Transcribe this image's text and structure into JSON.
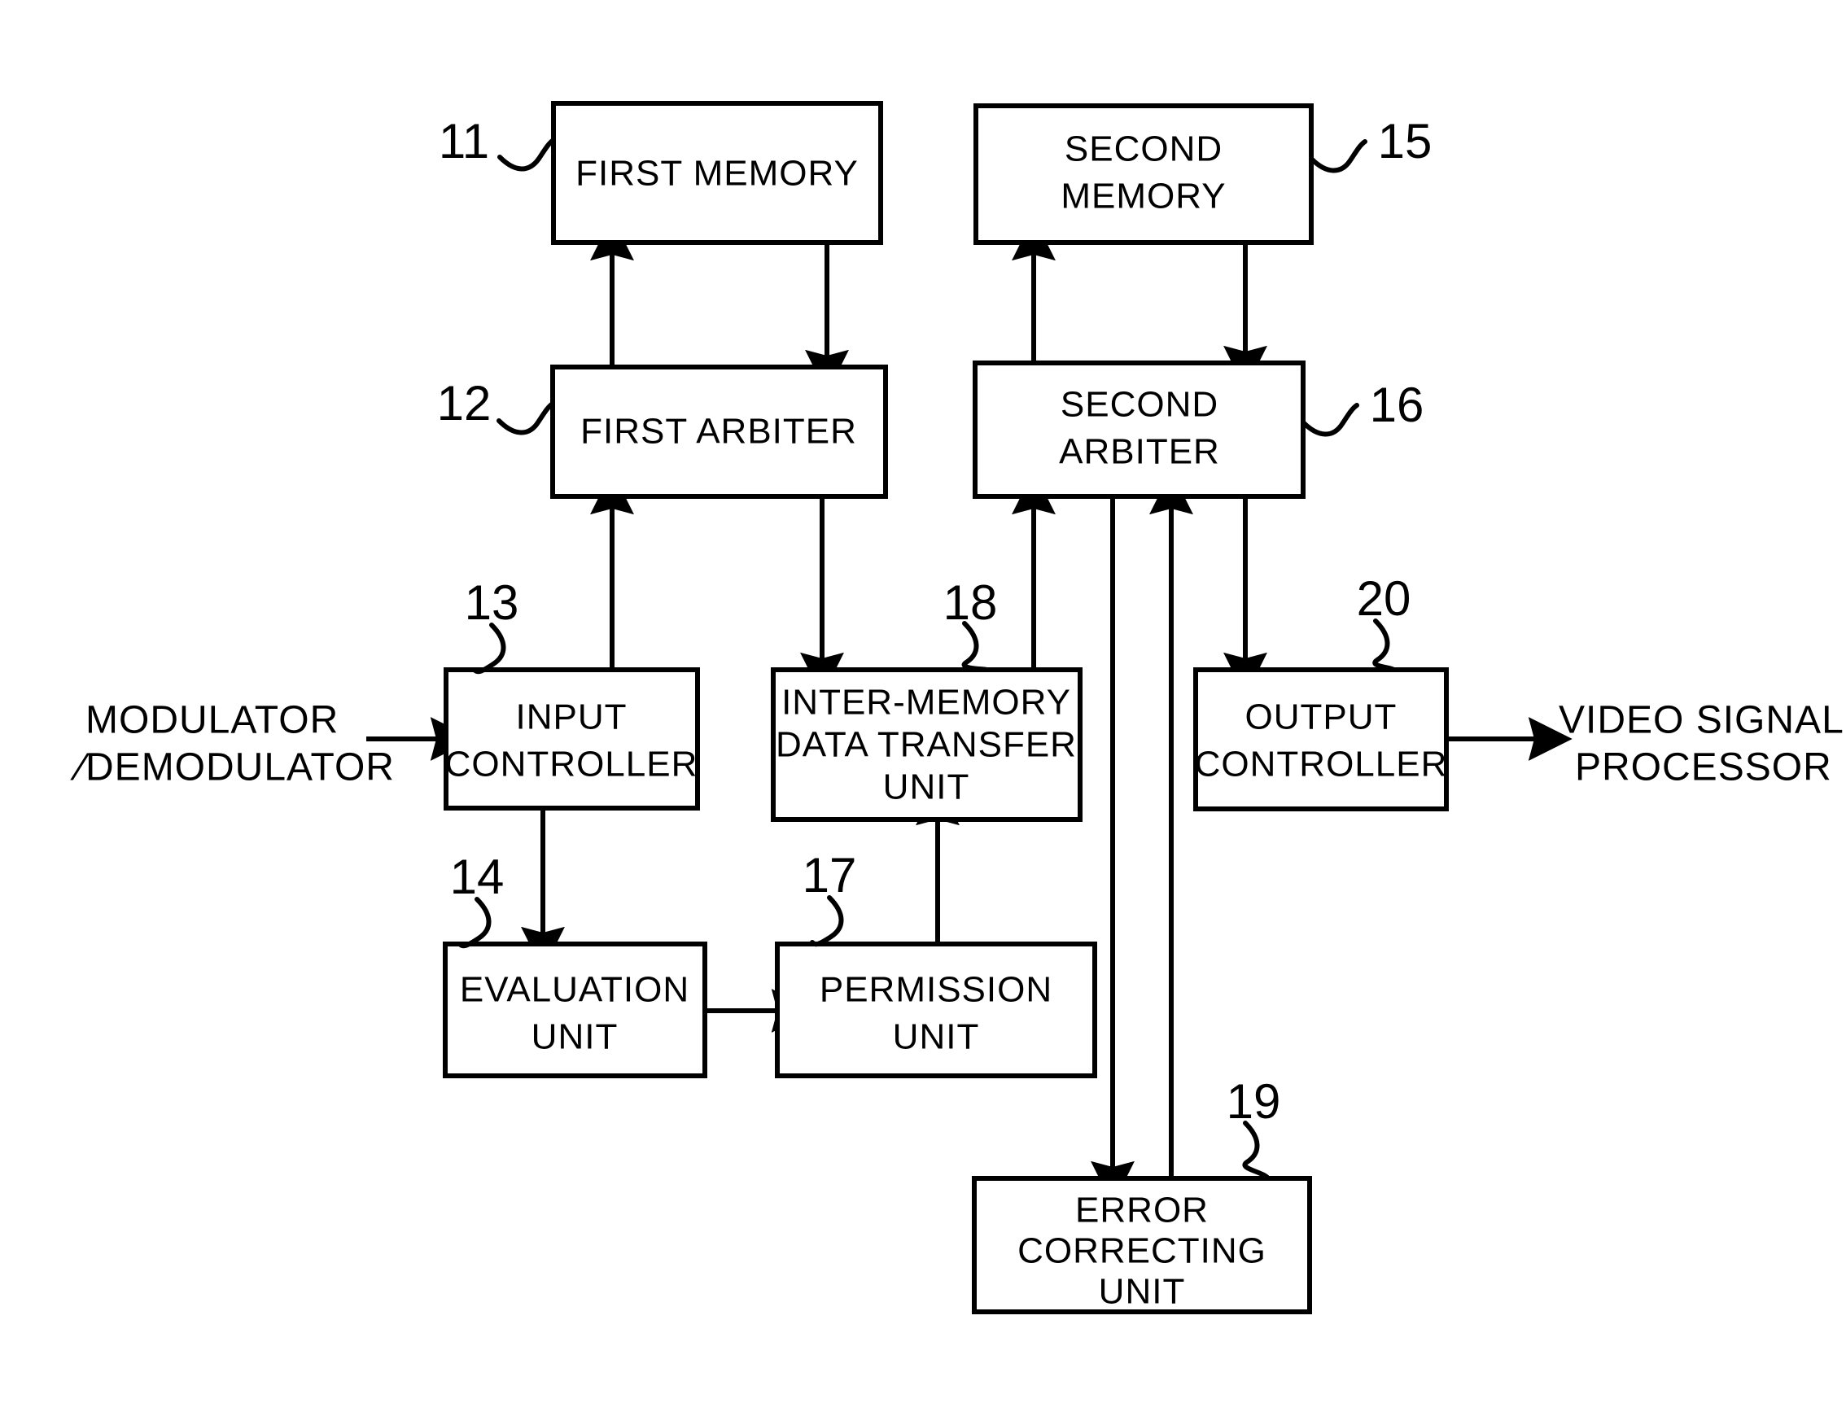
{
  "figure": {
    "type": "patent-block-diagram",
    "background": "#ffffff",
    "stroke_color": "#000000"
  },
  "blocks": [
    {
      "id": "first_memory",
      "ref": "11",
      "label_lines": [
        "FIRST  MEMORY"
      ]
    },
    {
      "id": "first_arbiter",
      "ref": "12",
      "label_lines": [
        "FIRST  ARBITER"
      ]
    },
    {
      "id": "input_controller",
      "ref": "13",
      "label_lines": [
        "INPUT",
        "CONTROLLER"
      ]
    },
    {
      "id": "evaluation_unit",
      "ref": "14",
      "label_lines": [
        "EVALUATION",
        "UNIT"
      ]
    },
    {
      "id": "second_memory",
      "ref": "15",
      "label_lines": [
        "SECOND",
        "MEMORY"
      ]
    },
    {
      "id": "second_arbiter",
      "ref": "16",
      "label_lines": [
        "SECOND",
        "ARBITER"
      ]
    },
    {
      "id": "permission_unit",
      "ref": "17",
      "label_lines": [
        "PERMISSION",
        "UNIT"
      ]
    },
    {
      "id": "inter_memory_unit",
      "ref": "18",
      "label_lines": [
        "INTER-MEMORY",
        "DATA  TRANSFER",
        "UNIT"
      ]
    },
    {
      "id": "error_correcting_unit",
      "ref": "19",
      "label_lines": [
        "ERROR",
        "CORRECTING",
        "UNIT"
      ]
    },
    {
      "id": "output_controller",
      "ref": "20",
      "label_lines": [
        "OUTPUT",
        "CONTROLLER"
      ]
    }
  ],
  "external_labels": [
    {
      "id": "modulator_demodulator",
      "lines": [
        "MODULATOR",
        "∕DEMODULATOR"
      ]
    },
    {
      "id": "video_signal_processor",
      "lines": [
        "VIDEO  SIGNAL",
        "PROCESSOR"
      ]
    }
  ],
  "reference_numerals": [
    "11",
    "12",
    "13",
    "14",
    "15",
    "16",
    "17",
    "18",
    "19",
    "20"
  ],
  "connections": [
    {
      "from": "input_controller",
      "to": "first_arbiter",
      "direction": "up"
    },
    {
      "from": "first_arbiter",
      "to": "first_memory",
      "direction": "up"
    },
    {
      "from": "first_memory",
      "to": "first_arbiter",
      "direction": "down"
    },
    {
      "from": "first_arbiter",
      "to": "inter_memory_unit",
      "direction": "down"
    },
    {
      "from": "inter_memory_unit",
      "to": "second_arbiter",
      "direction": "up"
    },
    {
      "from": "second_arbiter",
      "to": "second_memory",
      "direction": "up"
    },
    {
      "from": "second_memory",
      "to": "second_arbiter",
      "direction": "down"
    },
    {
      "from": "second_arbiter",
      "to": "output_controller",
      "direction": "down"
    },
    {
      "from": "second_arbiter",
      "to": "error_correcting_unit",
      "direction": "down"
    },
    {
      "from": "error_correcting_unit",
      "to": "second_arbiter",
      "direction": "up"
    },
    {
      "from": "input_controller",
      "to": "evaluation_unit",
      "direction": "down"
    },
    {
      "from": "evaluation_unit",
      "to": "permission_unit",
      "direction": "right"
    },
    {
      "from": "permission_unit",
      "to": "inter_memory_unit",
      "direction": "up"
    },
    {
      "from": "modulator_demodulator",
      "to": "input_controller",
      "direction": "right"
    },
    {
      "from": "output_controller",
      "to": "video_signal_processor",
      "direction": "right"
    }
  ]
}
